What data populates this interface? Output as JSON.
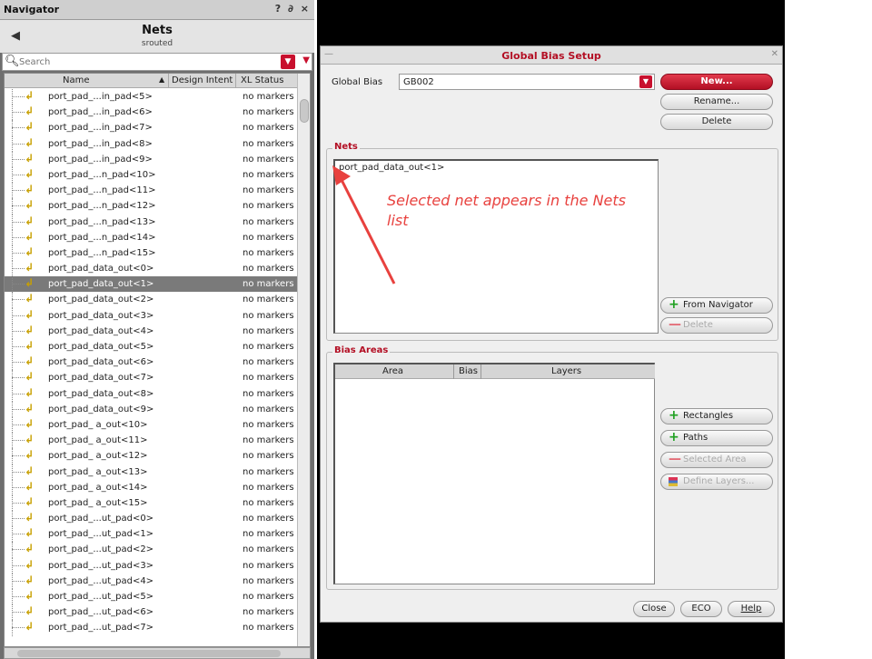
{
  "navigator": {
    "window_title": "Navigator",
    "window_controls": "? ∂ ×",
    "back_glyph": "◀",
    "title": "Nets",
    "subtitle": "srouted",
    "search_placeholder": "Search",
    "columns": [
      "Name",
      "Design Intent",
      "XL Status"
    ],
    "rows": [
      {
        "name": "port_pad_...in_pad<5>",
        "status": "no markers"
      },
      {
        "name": "port_pad_...in_pad<6>",
        "status": "no markers"
      },
      {
        "name": "port_pad_...in_pad<7>",
        "status": "no markers"
      },
      {
        "name": "port_pad_...in_pad<8>",
        "status": "no markers"
      },
      {
        "name": "port_pad_...in_pad<9>",
        "status": "no markers"
      },
      {
        "name": "port_pad_...n_pad<10>",
        "status": "no markers"
      },
      {
        "name": "port_pad_...n_pad<11>",
        "status": "no markers"
      },
      {
        "name": "port_pad_...n_pad<12>",
        "status": "no markers"
      },
      {
        "name": "port_pad_...n_pad<13>",
        "status": "no markers"
      },
      {
        "name": "port_pad_...n_pad<14>",
        "status": "no markers"
      },
      {
        "name": "port_pad_...n_pad<15>",
        "status": "no markers"
      },
      {
        "name": "port_pad_data_out<0>",
        "status": "no markers"
      },
      {
        "name": "port_pad_data_out<1>",
        "status": "no markers",
        "selected": true
      },
      {
        "name": "port_pad_data_out<2>",
        "status": "no markers"
      },
      {
        "name": "port_pad_data_out<3>",
        "status": "no markers"
      },
      {
        "name": "port_pad_data_out<4>",
        "status": "no markers"
      },
      {
        "name": "port_pad_data_out<5>",
        "status": "no markers"
      },
      {
        "name": "port_pad_data_out<6>",
        "status": "no markers"
      },
      {
        "name": "port_pad_data_out<7>",
        "status": "no markers"
      },
      {
        "name": "port_pad_data_out<8>",
        "status": "no markers"
      },
      {
        "name": "port_pad_data_out<9>",
        "status": "no markers"
      },
      {
        "name": "port_pad_ a_out<10>",
        "status": "no markers"
      },
      {
        "name": "port_pad_ a_out<11>",
        "status": "no markers"
      },
      {
        "name": "port_pad_ a_out<12>",
        "status": "no markers"
      },
      {
        "name": "port_pad_ a_out<13>",
        "status": "no markers"
      },
      {
        "name": "port_pad_ a_out<14>",
        "status": "no markers"
      },
      {
        "name": "port_pad_ a_out<15>",
        "status": "no markers"
      },
      {
        "name": "port_pad_...ut_pad<0>",
        "status": "no markers"
      },
      {
        "name": "port_pad_...ut_pad<1>",
        "status": "no markers"
      },
      {
        "name": "port_pad_...ut_pad<2>",
        "status": "no markers"
      },
      {
        "name": "port_pad_...ut_pad<3>",
        "status": "no markers"
      },
      {
        "name": "port_pad_...ut_pad<4>",
        "status": "no markers"
      },
      {
        "name": "port_pad_...ut_pad<5>",
        "status": "no markers"
      },
      {
        "name": "port_pad_...ut_pad<6>",
        "status": "no markers"
      },
      {
        "name": "port_pad_...ut_pad<7>",
        "status": "no markers"
      }
    ]
  },
  "dialog": {
    "title": "Global Bias Setup",
    "global_bias_label": "Global Bias",
    "global_bias_value": "GB002",
    "buttons": {
      "new": "New...",
      "rename": "Rename...",
      "delete": "Delete",
      "from_navigator": "From Navigator",
      "nets_delete": "Delete",
      "rectangles": "Rectangles",
      "paths": "Paths",
      "selected_area": "Selected Area",
      "define_layers": "Define Layers...",
      "close": "Close",
      "eco": "ECO",
      "help": "Help"
    },
    "nets_group_label": "Nets",
    "nets_list": [
      "port_pad_data_out<1>"
    ],
    "bias_areas_label": "Bias Areas",
    "bias_columns": [
      "Area",
      "Bias",
      "Layers"
    ]
  },
  "annotation": {
    "text": "Selected net appears in the Nets list",
    "color": "#e8413e"
  },
  "colors": {
    "accent": "#b30f24",
    "add_icon": "#1ea020",
    "selection": "#7a7a7a"
  }
}
